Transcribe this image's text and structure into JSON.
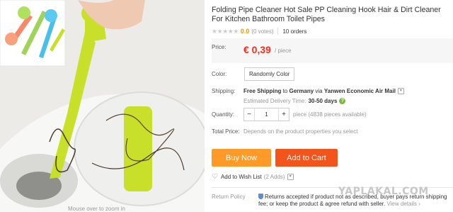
{
  "product": {
    "title": "Folding Pipe Cleaner Hot Sale PP Cleaning Hook Hair & Dirt Cleaner For Kitchen Bathroom Toilet Pipes",
    "stars": "★★★★★",
    "rating": "0.0",
    "votes": "(0 votes)",
    "orders": "10 orders",
    "zoom_hint": "Mouse over to zoom in"
  },
  "price": {
    "label": "Price:",
    "value": "€ 0,39",
    "unit": "/ piece"
  },
  "color": {
    "label": "Color:",
    "selected": "Randomly Color"
  },
  "shipping": {
    "label": "Shipping:",
    "free": "Free Shipping",
    "to": "to",
    "country": "Germany",
    "via": "via",
    "carrier": "Yanwen Economic Air Mail",
    "delivery_label": "Estimated Delivery Time:",
    "delivery_value": "30-50 days"
  },
  "quantity": {
    "label": "Quantity:",
    "minus": "−",
    "value": "1",
    "plus": "+",
    "available": "piece (4838 pieces available)"
  },
  "total": {
    "label": "Total Price:",
    "note": "Depends on the product properties you select"
  },
  "actions": {
    "buy_now": "Buy Now",
    "add_to_cart": "Add to Cart",
    "wish": "Add to Wish List",
    "wish_count": "(2 Adds)"
  },
  "return_policy": {
    "label": "Return Policy",
    "text": "Returns accepted if product not as described, buyer pays return shipping fee; or keep the product & agree refund with seller.",
    "view_details": "View details ›"
  },
  "watermark": "YAPLAKAL.COM",
  "colors": {
    "price": "#f42d1e",
    "buy_now": "#ff9a29",
    "add_to_cart": "#f2541c",
    "hook": "#c8e02a"
  }
}
